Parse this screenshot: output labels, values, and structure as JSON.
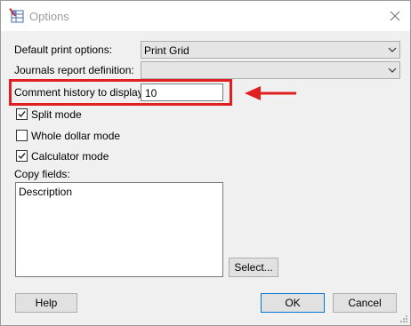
{
  "window": {
    "title": "Options",
    "close_icon": "close-icon",
    "app_icon": "options-grid-icon"
  },
  "form": {
    "default_print_options": {
      "label": "Default print options:",
      "value": "Print Grid"
    },
    "journals_report_definition": {
      "label": "Journals report definition:",
      "value": ""
    },
    "comment_history": {
      "label": "Comment history to display:",
      "value": "10"
    },
    "split_mode": {
      "label": "Split mode",
      "checked": true
    },
    "whole_dollar_mode": {
      "label": "Whole dollar mode",
      "checked": false
    },
    "calculator_mode": {
      "label": "Calculator mode",
      "checked": true
    },
    "copy_fields": {
      "label": "Copy fields:",
      "items": [
        "Description"
      ]
    },
    "select_button": "Select..."
  },
  "buttons": {
    "help": "Help",
    "ok": "OK",
    "cancel": "Cancel"
  },
  "annotation": {
    "highlight_color": "#e02020"
  }
}
